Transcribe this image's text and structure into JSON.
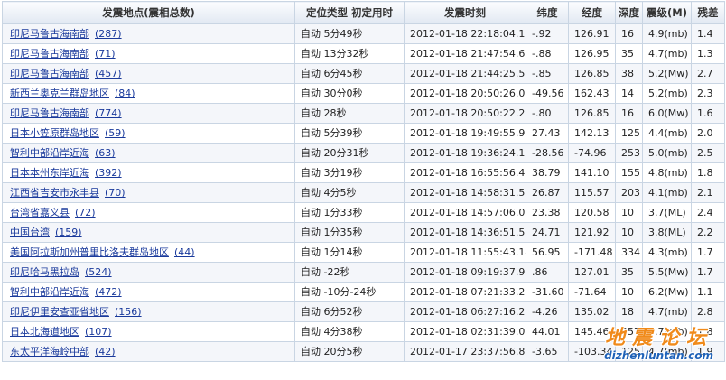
{
  "headers": {
    "location": "发震地点(震相总数)",
    "type": "定位类型 初定用时",
    "time": "发震时刻",
    "lat": "纬度",
    "lon": "经度",
    "depth": "深度",
    "mag": "震级(M)",
    "residual": "残差"
  },
  "rows": [
    {
      "place": "印尼马鲁古海南部",
      "count": "(287)",
      "type": "自动 5分49秒",
      "time": "2012-01-18 22:18:04.180",
      "lat": "-.92",
      "lon": "126.91",
      "depth": "16",
      "mag": "4.9(mb)",
      "res": "1.4"
    },
    {
      "place": "印尼马鲁古海南部",
      "count": "(71)",
      "type": "自动 13分32秒",
      "time": "2012-01-18 21:47:54.690",
      "lat": "-.88",
      "lon": "126.95",
      "depth": "35",
      "mag": "4.7(mb)",
      "res": "1.3"
    },
    {
      "place": "印尼马鲁古海南部",
      "count": "(457)",
      "type": "自动 6分45秒",
      "time": "2012-01-18 21:44:25.550",
      "lat": "-.85",
      "lon": "126.85",
      "depth": "38",
      "mag": "5.2(Mw)",
      "res": "2.7"
    },
    {
      "place": "新西兰奥克兰群岛地区",
      "count": "(84)",
      "type": "自动 30分0秒",
      "time": "2012-01-18 20:50:26.050",
      "lat": "-49.56",
      "lon": "162.43",
      "depth": "14",
      "mag": "5.2(mb)",
      "res": "2.3"
    },
    {
      "place": "印尼马鲁古海南部",
      "count": "(774)",
      "type": "自动 28秒",
      "time": "2012-01-18 20:50:22.250",
      "lat": "-.80",
      "lon": "126.85",
      "depth": "16",
      "mag": "6.0(Mw)",
      "res": "1.6"
    },
    {
      "place": "日本小笠原群岛地区",
      "count": "(59)",
      "type": "自动 5分39秒",
      "time": "2012-01-18 19:49:55.990",
      "lat": "27.43",
      "lon": "142.13",
      "depth": "125",
      "mag": "4.4(mb)",
      "res": "2.0"
    },
    {
      "place": "智利中部沿岸近海",
      "count": "(63)",
      "type": "自动 20分31秒",
      "time": "2012-01-18 19:36:24.190",
      "lat": "-28.56",
      "lon": "-74.96",
      "depth": "253",
      "mag": "5.0(mb)",
      "res": "2.5"
    },
    {
      "place": "日本本州东岸近海",
      "count": "(392)",
      "type": "自动 3分19秒",
      "time": "2012-01-18 16:55:56.460",
      "lat": "38.79",
      "lon": "141.10",
      "depth": "155",
      "mag": "4.8(mb)",
      "res": "1.8"
    },
    {
      "place": "江西省吉安市永丰县",
      "count": "(70)",
      "type": "自动 4分5秒",
      "time": "2012-01-18 14:58:31.530",
      "lat": "26.87",
      "lon": "115.57",
      "depth": "203",
      "mag": "4.1(mb)",
      "res": "2.1"
    },
    {
      "place": "台湾省嘉义县",
      "count": "(72)",
      "type": "自动 1分33秒",
      "time": "2012-01-18 14:57:06.030",
      "lat": "23.38",
      "lon": "120.58",
      "depth": "10",
      "mag": "3.7(ML)",
      "res": "2.4"
    },
    {
      "place": "中国台湾",
      "count": "(159)",
      "type": "自动 1分35秒",
      "time": "2012-01-18 14:36:51.550",
      "lat": "24.71",
      "lon": "121.92",
      "depth": "10",
      "mag": "3.8(ML)",
      "res": "2.2"
    },
    {
      "place": "美国阿拉斯加州普里比洛夫群岛地区",
      "count": "(44)",
      "type": "自动 1分14秒",
      "time": "2012-01-18 11:55:43.140",
      "lat": "56.95",
      "lon": "-171.48",
      "depth": "334",
      "mag": "4.3(mb)",
      "res": "1.7"
    },
    {
      "place": "印尼哈马黑拉岛",
      "count": "(524)",
      "type": "自动 -22秒",
      "time": "2012-01-18 09:19:37.930",
      "lat": ".86",
      "lon": "127.01",
      "depth": "35",
      "mag": "5.5(Mw)",
      "res": "1.7"
    },
    {
      "place": "智利中部沿岸近海",
      "count": "(472)",
      "type": "自动 -10分-24秒",
      "time": "2012-01-18 07:21:33.290",
      "lat": "-31.60",
      "lon": "-71.64",
      "depth": "10",
      "mag": "6.2(Mw)",
      "res": "1.1"
    },
    {
      "place": "印尼伊里安查亚省地区",
      "count": "(156)",
      "type": "自动 6分52秒",
      "time": "2012-01-18 06:27:16.210",
      "lat": "-4.26",
      "lon": "135.02",
      "depth": "18",
      "mag": "4.7(mb)",
      "res": "2.8"
    },
    {
      "place": "日本北海道地区",
      "count": "(107)",
      "type": "自动 4分38秒",
      "time": "2012-01-18 02:31:39.060",
      "lat": "44.01",
      "lon": "145.46",
      "depth": "357",
      "mag": "4.7(mb)",
      "res": "1.8"
    },
    {
      "place": "东太平洋海岭中部",
      "count": "(42)",
      "type": "自动 20分5秒",
      "time": "2012-01-17 23:37:56.810",
      "lat": "-3.65",
      "lon": "-103.34",
      "depth": "125",
      "mag": "4.7(mb)",
      "res": "1.9"
    }
  ],
  "watermark": {
    "title": "地震论坛",
    "url": "dizhenluntan.com"
  }
}
